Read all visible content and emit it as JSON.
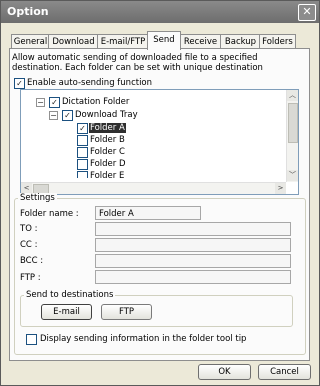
{
  "window": {
    "title": "Option",
    "close_glyph": "✕"
  },
  "tabs": [
    {
      "label": "General"
    },
    {
      "label": "Download"
    },
    {
      "label": "E-mail/FTP"
    },
    {
      "label": "Send"
    },
    {
      "label": "Receive"
    },
    {
      "label": "Backup"
    },
    {
      "label": "Folders"
    }
  ],
  "description": "Allow automatic sending of downloaded file to a specified destination. Each folder can be set with unique destination",
  "auto_send": {
    "label": "Enable auto-sending function",
    "checked": true
  },
  "tree": {
    "items": [
      {
        "label": "Dictation Folder"
      },
      {
        "label": "Download Tray"
      },
      {
        "label": "Folder A"
      },
      {
        "label": "Folder B"
      },
      {
        "label": "Folder C"
      },
      {
        "label": "Folder D"
      },
      {
        "label": "Folder E"
      }
    ]
  },
  "settings": {
    "group_label": "Settings",
    "folder_name_label": "Folder name :",
    "folder_name_value": "Folder A",
    "to_label": "TO :",
    "cc_label": "CC :",
    "bcc_label": "BCC :",
    "ftp_label": "FTP :"
  },
  "send_destinations": {
    "group_label": "Send to destinations",
    "email_button": "E-mail",
    "ftp_button": "FTP"
  },
  "tooltip_option": {
    "label": "Display sending information in the folder tool tip",
    "checked": false
  },
  "footer": {
    "ok": "OK",
    "cancel": "Cancel"
  }
}
